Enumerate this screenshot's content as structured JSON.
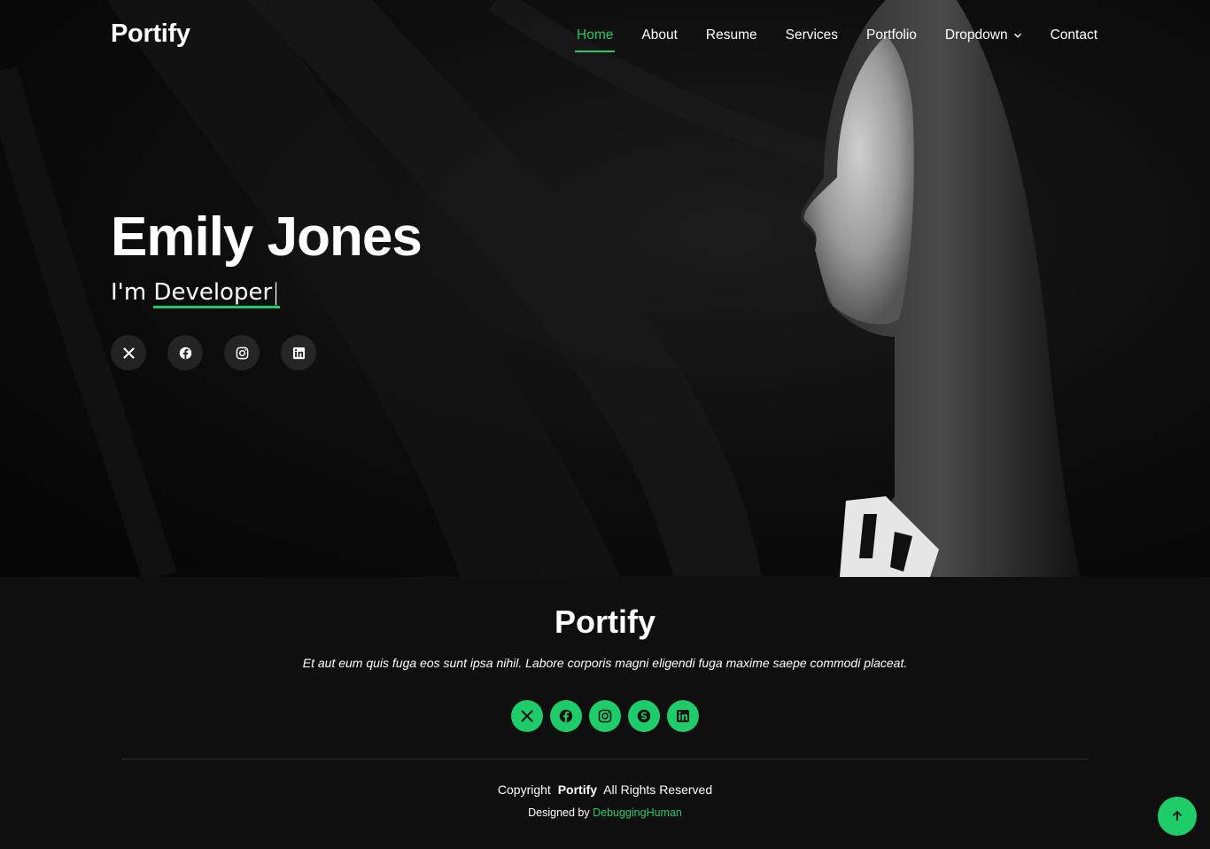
{
  "header": {
    "logo": "Portify",
    "nav": [
      {
        "label": "Home",
        "active": true
      },
      {
        "label": "About"
      },
      {
        "label": "Resume"
      },
      {
        "label": "Services"
      },
      {
        "label": "Portfolio"
      },
      {
        "label": "Dropdown",
        "has_dropdown": true
      },
      {
        "label": "Contact"
      }
    ]
  },
  "hero": {
    "name": "Emily Jones",
    "prefix": "I'm",
    "typed_word": "Developer",
    "cursor": "|",
    "social": [
      {
        "icon": "x-twitter-icon"
      },
      {
        "icon": "facebook-icon"
      },
      {
        "icon": "instagram-icon"
      },
      {
        "icon": "linkedin-icon"
      }
    ]
  },
  "footer": {
    "title": "Portify",
    "description": "Et aut eum quis fuga eos sunt ipsa nihil. Labore corporis magni eligendi fuga maxime saepe commodi placeat.",
    "social": [
      {
        "icon": "x-twitter-icon"
      },
      {
        "icon": "facebook-icon"
      },
      {
        "icon": "instagram-icon"
      },
      {
        "icon": "skype-icon"
      },
      {
        "icon": "linkedin-icon"
      }
    ],
    "copyright_prefix": "Copyright",
    "copyright_brand": "Portify",
    "copyright_suffix": "All Rights Reserved",
    "credit_prefix": "Designed by",
    "credit_link": "DebuggingHuman"
  },
  "colors": {
    "accent": "#1fcc6a",
    "background": "#0f0f0f"
  }
}
